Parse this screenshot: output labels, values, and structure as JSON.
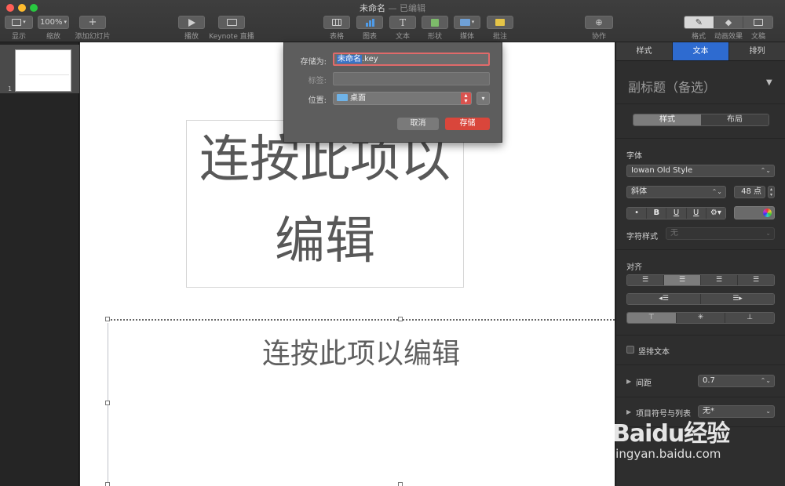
{
  "window": {
    "title": "未命名",
    "subtitle": "— 已编辑"
  },
  "toolbar": {
    "view": "显示",
    "zoom_value": "100%",
    "zoom": "缩放",
    "add_slide": "添加幻灯片",
    "play": "播放",
    "keynote_live": "Keynote 直播",
    "table": "表格",
    "chart": "图表",
    "text": "文本",
    "shape": "形状",
    "media": "媒体",
    "comment": "批注",
    "collaborate": "协作",
    "format": "格式",
    "animate": "动画效果",
    "document": "文稿"
  },
  "navigator": {
    "slide_number": "1"
  },
  "slide": {
    "title_line1": "连按此项以",
    "title_line2": "编辑",
    "subtitle": "连按此项以编辑"
  },
  "save_dialog": {
    "save_as_label": "存储为:",
    "filename_selected": "未命名",
    "filename_ext": ".key",
    "tags_label": "标签:",
    "tags_value": "",
    "where_label": "位置:",
    "where_value": "桌面",
    "cancel": "取消",
    "save": "存储"
  },
  "inspector": {
    "tabs": [
      "样式",
      "文本",
      "排列"
    ],
    "active_tab": "文本",
    "paragraph_style": "副标题（备选）",
    "seg_style": "样式",
    "seg_layout": "布局",
    "font_heading": "字体",
    "font_family": "Iowan Old Style",
    "font_typeface": "斜体",
    "font_size": "48 点",
    "format_buttons": [
      "•",
      "B",
      "U",
      "U",
      "⚙▾"
    ],
    "char_style_label": "字符样式",
    "char_style_value": "无",
    "align_heading": "对齐",
    "vertical_text": "竖排文本",
    "spacing_label": "间距",
    "spacing_value": "0.7",
    "bullets_label": "项目符号与列表",
    "bullets_value": "无*"
  },
  "watermark": {
    "main": "Baidu经验",
    "sub": "jingyan.baidu.com"
  },
  "colors": {
    "accent_blue": "#2e6bd0",
    "save_red": "#d9463b",
    "window_dark": "#2b2b2b"
  }
}
